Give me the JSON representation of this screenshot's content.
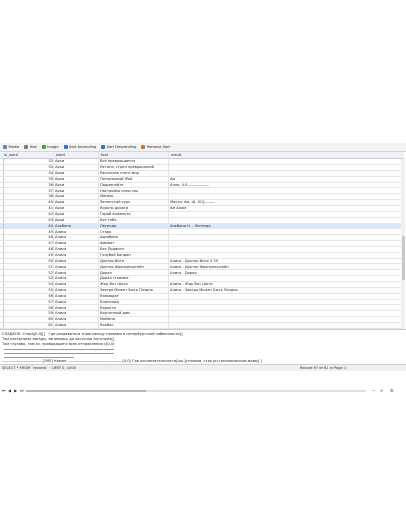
{
  "toolbar": {
    "items": [
      {
        "label": "Media",
        "color": "#5b87c9"
      },
      {
        "label": "Hex",
        "color": "#7c7c7c"
      },
      {
        "label": "Image",
        "color": "#4aa04a"
      },
      {
        "label": "Sort Ascending",
        "color": "#3a6fc6"
      },
      {
        "label": "Sort Descending",
        "color": "#3a6fc6"
      },
      {
        "label": "Remove Sort",
        "color": "#c67a2a"
      }
    ]
  },
  "columns": [
    "in_word",
    "word",
    "text",
    "result"
  ],
  "rows": [
    {
      "id": "32",
      "word": "Архи",
      "text": "Всё превращается",
      "result": ""
    },
    {
      "id": "33",
      "word": "Архи",
      "text": "Истина, стрел превращений",
      "result": ""
    },
    {
      "id": "34",
      "word": "Архи",
      "text": "Рассказка этого мир",
      "result": ""
    },
    {
      "id": "35",
      "word": "Архи",
      "text": "Потерянный iPad",
      "result": "Ам"
    },
    {
      "id": "36",
      "word": "Архи",
      "text": "Подменяйте",
      "result": "Алло: 4.0——————"
    },
    {
      "id": "37",
      "word": "Архи",
      "text": "Настройка силы эль",
      "result": ""
    },
    {
      "id": "38",
      "word": "Архи",
      "text": "Минеш",
      "result": ""
    },
    {
      "id": "40",
      "word": "Архи",
      "text": "Запекутый курс",
      "result": "Мечта: Ам, Ш, Ю(]———"
    },
    {
      "id": "41",
      "word": "Архи",
      "text": "Король дороги",
      "result": "Ам        Алим"
    },
    {
      "id": "42",
      "word": "Архи",
      "text": "Герой асфальта",
      "result": ""
    },
    {
      "id": "43",
      "word": "Архи",
      "text": "Без тебя",
      "result": ""
    },
    {
      "id": "44",
      "word": "Альбина",
      "text": "Легенда",
      "result": "Альбина Н. - Легенда"
    },
    {
      "id": "45",
      "word": "Алиса",
      "text": "Старо",
      "result": ""
    },
    {
      "id": "46",
      "word": "Алиса",
      "text": "Аэробика",
      "result": ""
    },
    {
      "id": "47",
      "word": "Алиса",
      "text": "Аммоат",
      "result": ""
    },
    {
      "id": "48",
      "word": "Алиса",
      "text": "Без Подвиги",
      "result": ""
    },
    {
      "id": "49",
      "word": "Алиса",
      "text": "Голубой Бандан",
      "result": ""
    },
    {
      "id": "50",
      "word": "Алиса",
      "text": "Доктор Вита",
      "result": "Алиса - Доктор Вите        3        30"
    },
    {
      "id": "51",
      "word": "Алиса",
      "text": "Доктор Франкенштейн",
      "result": "Алиса - Доктор Франкенштейн"
    },
    {
      "id": "52",
      "word": "Алиса",
      "text": "Дорая",
      "result": "Алиса - Дорая"
    },
    {
      "id": "53",
      "word": "Алиса",
      "text": "Дорая стоимке",
      "result": ""
    },
    {
      "id": "54",
      "word": "Алиса",
      "text": "Жар Вот Шота",
      "result": "Алиса - Жар Вот Шота"
    },
    {
      "id": "55",
      "word": "Алиса",
      "text": "Завтра Может Быть Поздно",
      "result": "Алиса - Завтра Может Быть Поздно"
    },
    {
      "id": "56",
      "word": "Алиса",
      "text": "Камиадзе",
      "result": ""
    },
    {
      "id": "57",
      "word": "Алиса",
      "text": "Клипепад",
      "result": ""
    },
    {
      "id": "58",
      "word": "Алиса",
      "text": "Каракти",
      "result": ""
    },
    {
      "id": "59",
      "word": "Алиса",
      "text": "Картонный дом",
      "result": ""
    },
    {
      "id": "60",
      "word": "Алиса",
      "text": "Миймпа",
      "result": ""
    },
    {
      "id": "61",
      "word": "Алиса",
      "text": "Колбас",
      "result": ""
    }
  ],
  "preview": {
    "lines": [
      "СЛАДКОЕ: Старо[0,0][] · Где раздаваться знаю между словами о петербургской забвенности[]",
      "    Там рассыпаны звезды, занимаясь да косточки Алгелине[]",
      "    Там глухово, там эх, проводящего всех отправления с[0,0]",
      "",
      "",
      "        ——————————— [ЭЛЕ] Камин, ———————————————[0,0] Где исключительности[шк.]стихами, стак рп-гополюческим мамы[ ]"
    ]
  },
  "status": {
    "left": "SELECT * FROM `records` · LIMIT 0, 1000",
    "right": "Record 97 of 61 in Page 1"
  }
}
